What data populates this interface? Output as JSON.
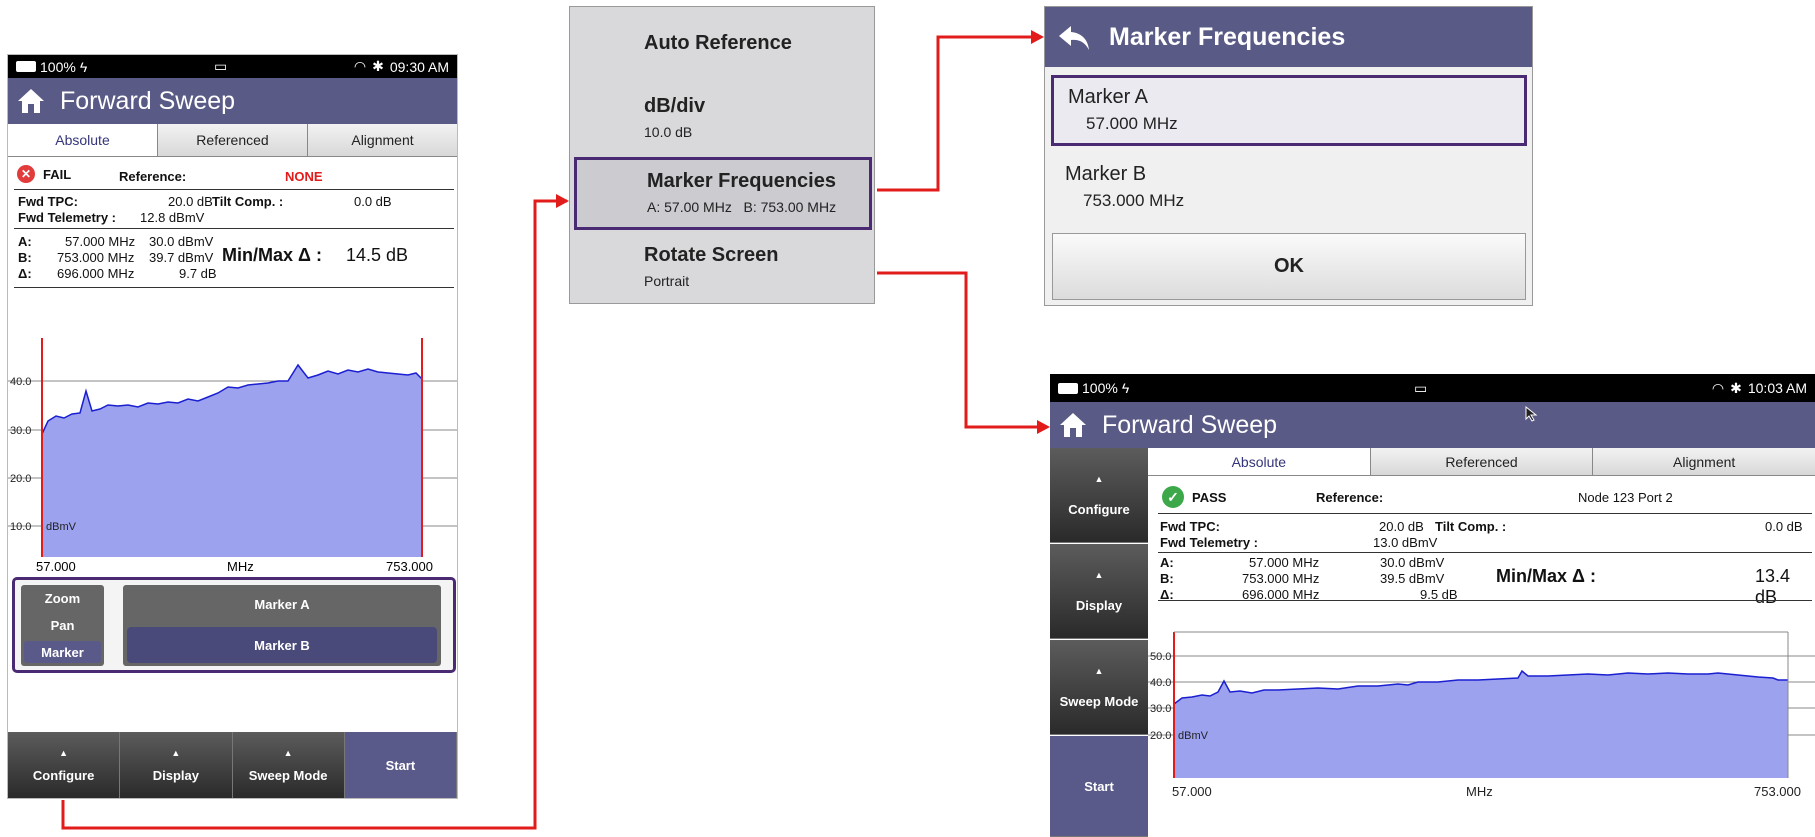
{
  "screen1": {
    "status": {
      "battery": "100%",
      "time": "09:30 AM"
    },
    "title": "Forward Sweep",
    "tabs": [
      "Absolute",
      "Referenced",
      "Alignment"
    ],
    "result": "FAIL",
    "reference_label": "Reference:",
    "reference_value": "NONE",
    "fwd_tpc_label": "Fwd TPC:",
    "fwd_tpc_value": "20.0 dB",
    "tilt_label": "Tilt Comp. :",
    "tilt_value": "0.0 dB",
    "fwd_tel_label": "Fwd Telemetry :",
    "fwd_tel_value": "12.8 dBmV",
    "markers": [
      {
        "k": "A:",
        "freq": "57.000 MHz",
        "level": "30.0 dBmV"
      },
      {
        "k": "B:",
        "freq": "753.000 MHz",
        "level": "39.7 dBmV"
      },
      {
        "k": "Δ:",
        "freq": "696.000 MHz",
        "level": "9.7 dB"
      }
    ],
    "minmax_label": "Min/Max Δ :",
    "minmax_value": "14.5 dB",
    "chart": {
      "y_ticks": [
        "40.0",
        "30.0",
        "20.0",
        "10.0"
      ],
      "unit": "dBmV",
      "x_start": "57.000",
      "x_unit": "MHz",
      "x_end": "753.000"
    },
    "mode_buttons": [
      "Zoom",
      "Pan",
      "Marker"
    ],
    "marker_buttons": [
      "Marker A",
      "Marker B"
    ],
    "bottom_nav": [
      "Configure",
      "Display",
      "Sweep Mode",
      "Start"
    ]
  },
  "menu": {
    "items": [
      {
        "label": "Auto Reference",
        "sub": ""
      },
      {
        "label": "dB/div",
        "sub": "10.0 dB"
      },
      {
        "label": "Marker Frequencies",
        "sub": "A: 57.00 MHz   B: 753.00 MHz"
      },
      {
        "label": "Rotate Screen",
        "sub": "Portrait"
      }
    ]
  },
  "dialog": {
    "title": "Marker Frequencies",
    "items": [
      {
        "name": "Marker A",
        "value": "57.000 MHz"
      },
      {
        "name": "Marker B",
        "value": "753.000 MHz"
      }
    ],
    "ok": "OK"
  },
  "screen2": {
    "status": {
      "battery": "100%",
      "time": "10:03 AM"
    },
    "title": "Forward Sweep",
    "tabs": [
      "Absolute",
      "Referenced",
      "Alignment"
    ],
    "side_nav": [
      "Configure",
      "Display",
      "Sweep Mode",
      "Start"
    ],
    "result": "PASS",
    "reference_label": "Reference:",
    "reference_value": "Node 123 Port 2",
    "fwd_tpc_label": "Fwd TPC:",
    "fwd_tpc_value": "20.0 dB",
    "tilt_label": "Tilt Comp. :",
    "tilt_value": "0.0 dB",
    "fwd_tel_label": "Fwd Telemetry :",
    "fwd_tel_value": "13.0 dBmV",
    "markers": [
      {
        "k": "A:",
        "freq": "57.000 MHz",
        "level": "30.0 dBmV"
      },
      {
        "k": "B:",
        "freq": "753.000 MHz",
        "level": "39.5 dBmV"
      },
      {
        "k": "Δ:",
        "freq": "696.000 MHz",
        "level": "9.5 dB"
      }
    ],
    "minmax_label": "Min/Max Δ :",
    "minmax_value": "13.4 dB",
    "chart": {
      "y_ticks": [
        "50.0",
        "40.0",
        "30.0",
        "20.0"
      ],
      "unit": "dBmV",
      "x_start": "57.000",
      "x_unit": "MHz",
      "x_end": "753.000"
    }
  },
  "colors": {
    "accent": "#5a5a86",
    "connector": "#e21b1b",
    "highlight": "#4a2a72",
    "trace_fill": "#9da2ee",
    "trace": "#1a1fd0"
  }
}
